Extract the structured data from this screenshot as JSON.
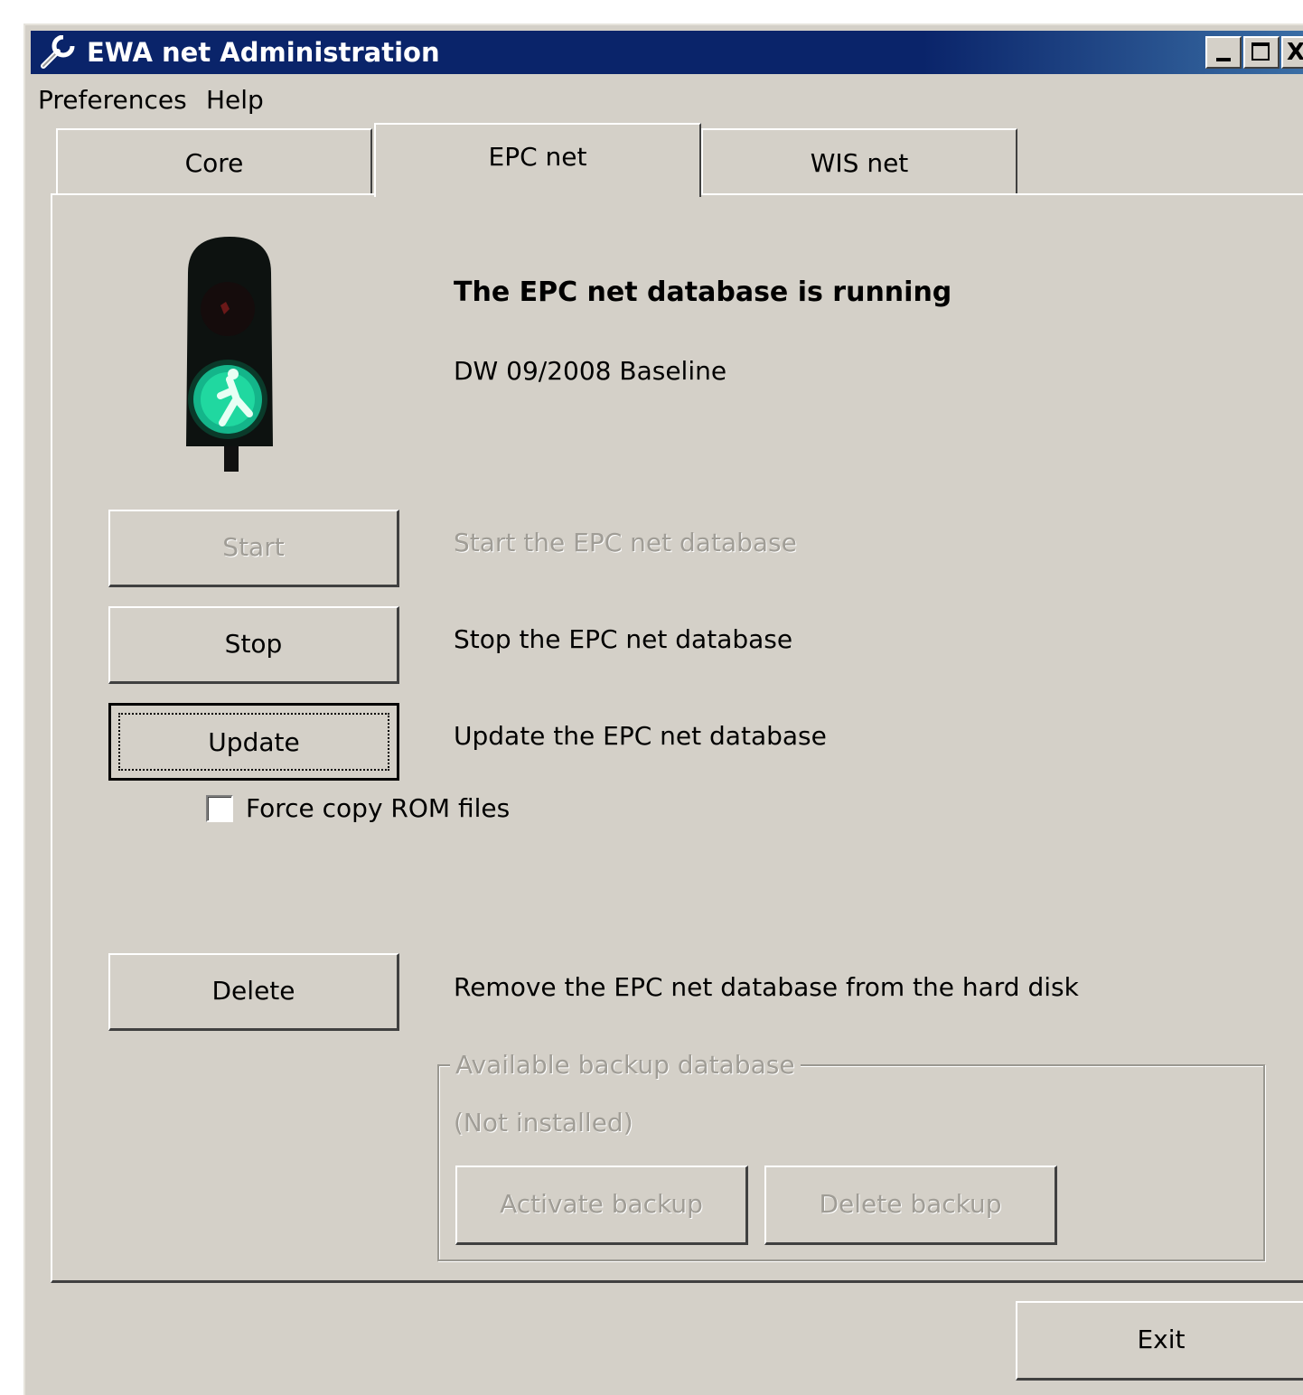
{
  "window": {
    "title": "EWA net Administration",
    "controls": {
      "minimize": "_",
      "maximize": "□",
      "close": "X"
    }
  },
  "menu": {
    "preferences": "Preferences",
    "help": "Help"
  },
  "tabs": [
    {
      "label": "Core",
      "active": false
    },
    {
      "label": "EPC net",
      "active": true
    },
    {
      "label": "WIS net",
      "active": false
    }
  ],
  "status": {
    "indicator": "green-traffic-light",
    "title": "The EPC net database is running",
    "version": "DW 09/2008 Baseline"
  },
  "actions": {
    "start": {
      "label": "Start",
      "description": "Start the EPC net database",
      "enabled": false
    },
    "stop": {
      "label": "Stop",
      "description": "Stop the EPC net database",
      "enabled": true
    },
    "update": {
      "label": "Update",
      "description": "Update the EPC net database",
      "enabled": true
    },
    "force_copy": {
      "label": "Force copy ROM files",
      "checked": false
    },
    "delete": {
      "label": "Delete",
      "description": "Remove the EPC net database from the hard disk",
      "enabled": true
    }
  },
  "backup": {
    "legend": "Available backup database",
    "status": "(Not installed)",
    "activate_label": "Activate backup",
    "delete_label": "Delete backup",
    "enabled": false
  },
  "footer": {
    "exit_label": "Exit"
  },
  "colors": {
    "titlebar": "#0a246a",
    "face": "#d4d0c8",
    "disabled_text": "#a09d96",
    "light_green": "#20d8a0"
  }
}
